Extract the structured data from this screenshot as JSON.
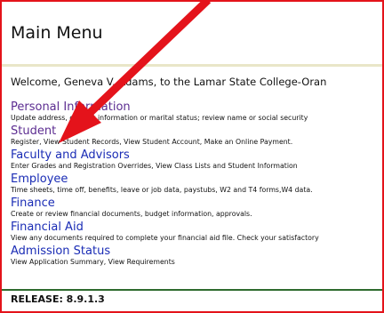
{
  "page": {
    "title": "Main Menu",
    "welcome": "Welcome, Geneva V. Adams, to the Lamar State College-Oran",
    "release": "RELEASE: 8.9.1.3"
  },
  "menu": {
    "items": [
      {
        "label": "Personal Information",
        "description": "Update address, contact information or marital status; review name or social security"
      },
      {
        "label": "Student",
        "description": "Register, View Student Records, View Student Account, Make an Online Payment."
      },
      {
        "label": "Faculty and Advisors",
        "description": "Enter Grades and Registration Overrides, View Class Lists and Student Information"
      },
      {
        "label": "Employee",
        "description": "Time sheets, time off, benefits, leave or job data, paystubs, W2 and T4 forms,W4 data."
      },
      {
        "label": "Finance",
        "description": "Create or review financial documents, budget information, approvals."
      },
      {
        "label": "Financial Aid",
        "description": "View any documents required to complete your financial aid file. Check your satisfactory"
      },
      {
        "label": "Admission Status",
        "description": "View Application Summary, View Requirements"
      }
    ]
  },
  "colors": {
    "frame_border": "#e4131b",
    "arrow": "#e4131b",
    "link": "#1a2cb5",
    "visited_link": "#5c2d91",
    "title_rule": "#e9e6c8",
    "bottom_rule": "#2e6b2e"
  },
  "icons": {
    "annotation_arrow": "red-arrow-icon"
  }
}
